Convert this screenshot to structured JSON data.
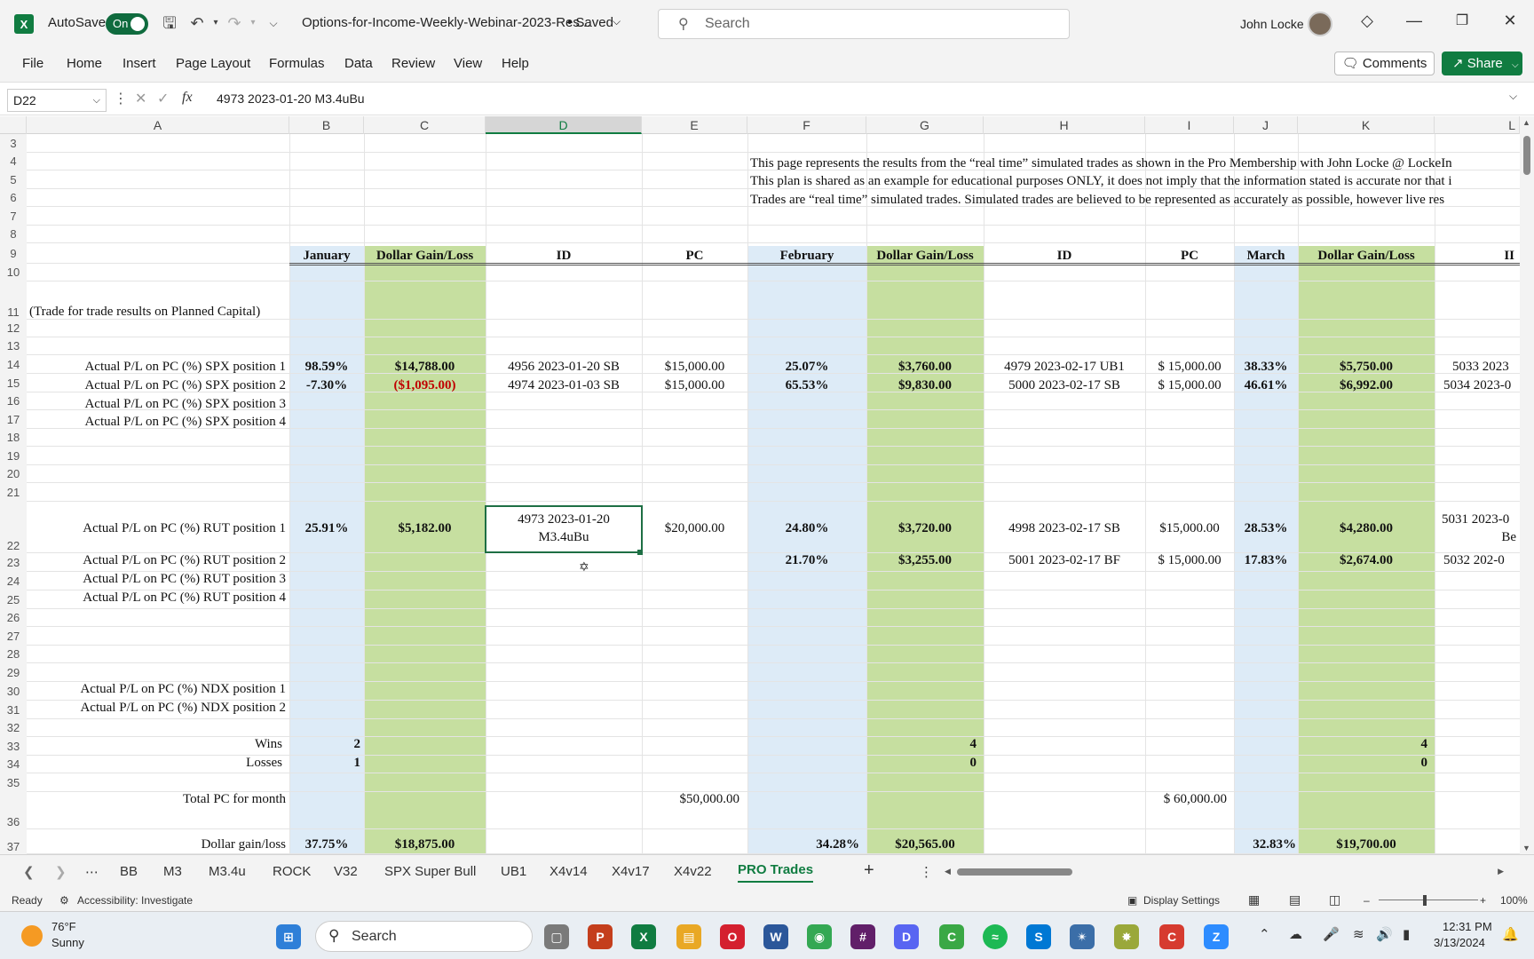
{
  "titlebar": {
    "app_icon": "X",
    "autosave_label": "AutoSave",
    "autosave_state": "On",
    "filename": "Options-for-Income-Weekly-Webinar-2023-Res...",
    "saved_state": "• Saved",
    "search_placeholder": "Search",
    "user_name": "John Locke"
  },
  "menu": [
    "File",
    "Home",
    "Insert",
    "Page Layout",
    "Formulas",
    "Data",
    "Review",
    "View",
    "Help"
  ],
  "comments_label": "Comments",
  "share_label": "Share",
  "formula_bar": {
    "name_box": "D22",
    "formula": "4973 2023-01-20 M3.4uBu"
  },
  "columns": [
    "A",
    "B",
    "C",
    "D",
    "E",
    "F",
    "G",
    "H",
    "I",
    "J",
    "K",
    "L"
  ],
  "rows": [
    "3",
    "4",
    "5",
    "6",
    "7",
    "8",
    "9",
    "10",
    "11",
    "12",
    "13",
    "14",
    "15",
    "16",
    "17",
    "18",
    "19",
    "20",
    "21",
    "22",
    "23",
    "24",
    "25",
    "26",
    "27",
    "28",
    "29",
    "30",
    "31",
    "32",
    "33",
    "34",
    "35",
    "36",
    "37"
  ],
  "notices": [
    "This page represents the results from the “real time” simulated trades as shown in the Pro Membership with John Locke @ LockeIn",
    "This plan is shared as an example for educational purposes ONLY, it does not imply that the information stated is accurate nor that i",
    "Trades are “real time” simulated trades. Simulated trades are believed to be represented as accurately as possible, however live res"
  ],
  "headers": {
    "b": "January",
    "c": "Dollar Gain/Loss",
    "d": "ID",
    "e": "PC",
    "f": "February",
    "g": "Dollar Gain/Loss",
    "h": "ID",
    "i": "PC",
    "j": "March",
    "k": "Dollar Gain/Loss",
    "l": "II"
  },
  "row_labels": {
    "r11": "(Trade for trade results on Planned Capital)",
    "r14": "Actual P/L on PC (%) SPX position 1",
    "r15": "Actual P/L on PC (%) SPX position 2",
    "r16": "Actual P/L on PC (%) SPX position 3",
    "r17": "Actual P/L on PC (%) SPX position 4",
    "r22": "Actual P/L on PC (%) RUT position 1",
    "r23": "Actual P/L on PC (%) RUT position 2",
    "r24": "Actual P/L on PC (%) RUT position 3",
    "r25": "Actual P/L on PC (%) RUT position 4",
    "r30": "Actual P/L on PC (%) NDX position 1",
    "r31": "Actual P/L on PC (%) NDX position 2",
    "r33": "Wins",
    "r34": "Losses",
    "r36": "Total PC for month",
    "r37": "Dollar gain/loss"
  },
  "cells": {
    "b14": "98.59%",
    "c14": "$14,788.00",
    "d14": "4956 2023-01-20 SB",
    "e14": "$15,000.00",
    "f14": "25.07%",
    "g14": "$3,760.00",
    "h14": "4979 2023-02-17 UB1",
    "i14": "$  15,000.00",
    "j14": "38.33%",
    "k14": "$5,750.00",
    "l14": "5033 2023",
    "b15": "-7.30%",
    "c15": "($1,095.00)",
    "d15": "4974 2023-01-03 SB",
    "e15": "$15,000.00",
    "f15": "65.53%",
    "g15": "$9,830.00",
    "h15": "5000 2023-02-17 SB",
    "i15": "$  15,000.00",
    "j15": "46.61%",
    "k15": "$6,992.00",
    "l15": "5034 2023-0",
    "b22": "25.91%",
    "c22": "$5,182.00",
    "d22_line1": "4973 2023-01-20",
    "d22_line2": "M3.4uBu",
    "e22": "$20,000.00",
    "f22": "24.80%",
    "g22": "$3,720.00",
    "h22": "4998 2023-02-17 SB",
    "i22": "$15,000.00",
    "j22": "28.53%",
    "k22": "$4,280.00",
    "l22_line1": "5031 2023-0",
    "l22_line2": "Be",
    "f23": "21.70%",
    "g23": "$3,255.00",
    "h23": "5001 2023-02-17 BF",
    "i23": "$  15,000.00",
    "j23": "17.83%",
    "k23": "$2,674.00",
    "l23": "5032 202-0",
    "b33": "2",
    "g33": "4",
    "k33": "4",
    "b34": "1",
    "g34": "0",
    "k34": "0",
    "e36": "$50,000.00",
    "i36": "$  60,000.00",
    "b37": "37.75%",
    "c37": "$18,875.00",
    "f37": "34.28%",
    "g37": "$20,565.00",
    "j37": "32.83%",
    "k37": "$19,700.00"
  },
  "sheet_tabs": [
    "BB",
    "M3",
    "M3.4u",
    "ROCK",
    "V32",
    "SPX Super Bull",
    "UB1",
    "X4v14",
    "X4v17",
    "X4v22",
    "PRO Trades"
  ],
  "active_tab": "PRO Trades",
  "status": {
    "ready": "Ready",
    "accessibility": "Accessibility: Investigate",
    "display_settings": "Display Settings",
    "zoom": "100%"
  },
  "taskbar": {
    "temperature": "76°F",
    "weather": "Sunny",
    "search_placeholder": "Search",
    "time": "12:31 PM",
    "date": "3/13/2024"
  },
  "colors": {
    "excel_green": "#107c41",
    "band_blue": "#ddebf7",
    "band_green": "#c6dfa0",
    "negative_red": "#c00000"
  }
}
